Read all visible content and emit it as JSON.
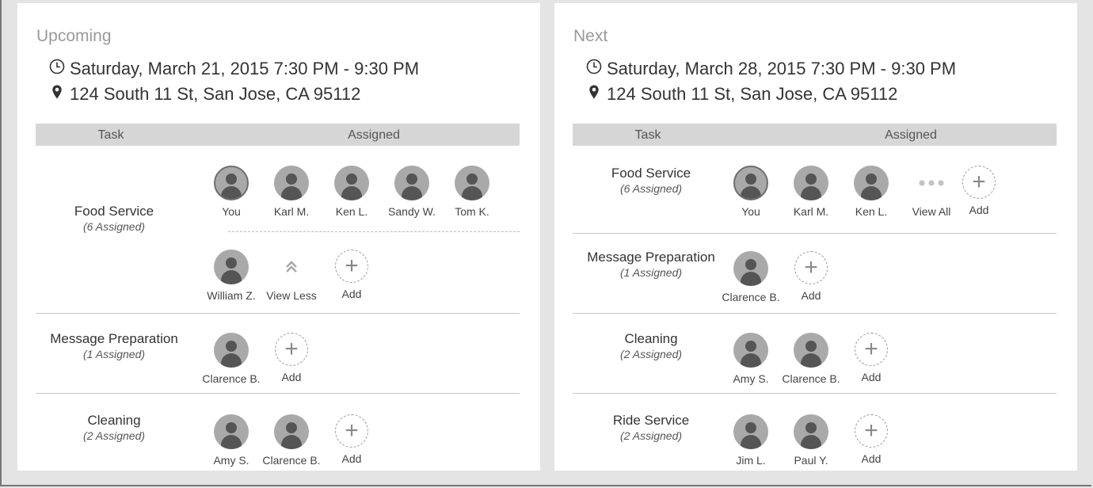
{
  "panels": [
    {
      "title": "Upcoming",
      "date": "Saturday, March 21, 2015  7:30 PM - 9:30 PM",
      "address": "124 South 11 St, San Jose, CA 95112",
      "header": {
        "task": "Task",
        "assigned": "Assigned"
      },
      "tasks": [
        {
          "name": "Food Service",
          "count": "(6 Assigned)",
          "slots": [
            {
              "type": "you",
              "label": "You"
            },
            {
              "type": "person",
              "label": "Karl M."
            },
            {
              "type": "person",
              "label": "Ken L."
            },
            {
              "type": "person",
              "label": "Sandy W."
            },
            {
              "type": "person",
              "label": "Tom K."
            },
            {
              "type": "person",
              "label": "William Z."
            },
            {
              "type": "less",
              "label": "View Less"
            },
            {
              "type": "add",
              "label": "Add"
            }
          ]
        },
        {
          "name": "Message Preparation",
          "count": "(1 Assigned)",
          "slots": [
            {
              "type": "person",
              "label": "Clarence B."
            },
            {
              "type": "add",
              "label": "Add"
            }
          ]
        },
        {
          "name": "Cleaning",
          "count": "(2 Assigned)",
          "slots": [
            {
              "type": "person",
              "label": "Amy S."
            },
            {
              "type": "person",
              "label": "Clarence B."
            },
            {
              "type": "add",
              "label": "Add"
            }
          ]
        }
      ]
    },
    {
      "title": "Next",
      "date": "Saturday, March 28, 2015  7:30 PM - 9:30 PM",
      "address": "124 South 11 St, San Jose, CA 95112",
      "header": {
        "task": "Task",
        "assigned": "Assigned"
      },
      "tasks": [
        {
          "name": "Food Service",
          "count": "(6 Assigned)",
          "slots": [
            {
              "type": "you",
              "label": "You"
            },
            {
              "type": "person",
              "label": "Karl M."
            },
            {
              "type": "person",
              "label": "Ken L."
            },
            {
              "type": "more",
              "label": "View All"
            },
            {
              "type": "add",
              "label": "Add"
            }
          ]
        },
        {
          "name": "Message Preparation",
          "count": "(1 Assigned)",
          "slots": [
            {
              "type": "person",
              "label": "Clarence B."
            },
            {
              "type": "add",
              "label": "Add"
            }
          ]
        },
        {
          "name": "Cleaning",
          "count": "(2 Assigned)",
          "slots": [
            {
              "type": "person",
              "label": "Amy S."
            },
            {
              "type": "person",
              "label": "Clarence B."
            },
            {
              "type": "add",
              "label": "Add"
            }
          ]
        },
        {
          "name": "Ride Service",
          "count": "(2 Assigned)",
          "slots": [
            {
              "type": "person",
              "label": "Jim L."
            },
            {
              "type": "person",
              "label": "Paul Y."
            },
            {
              "type": "add",
              "label": "Add"
            }
          ]
        }
      ]
    }
  ],
  "icons": {
    "clock": "clock-icon",
    "location": "map-pin-icon",
    "avatar": "user-avatar-icon",
    "add": "plus-icon",
    "less": "chevron-double-up-icon",
    "more": "ellipsis-icon"
  }
}
